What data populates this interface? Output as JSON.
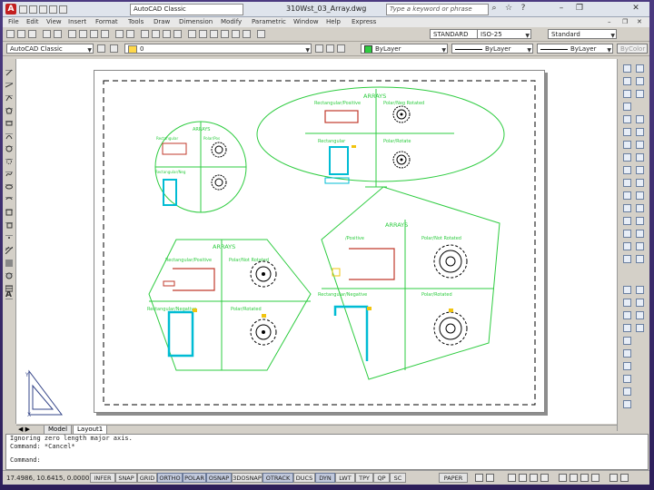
{
  "window": {
    "workspace": "AutoCAD Classic",
    "title": "310Wst_03_Array.dwg",
    "search_placeholder": "Type a keyword or phrase"
  },
  "menu": [
    "File",
    "Edit",
    "View",
    "Insert",
    "Format",
    "Tools",
    "Draw",
    "Dimension",
    "Modify",
    "Parametric",
    "Window",
    "Help",
    "Express"
  ],
  "toolbar2": {
    "workspace_combo": "AutoCAD Classic",
    "text_style": "STANDARD",
    "dim_style": "ISO-25",
    "table_style": "Standard"
  },
  "toolbar3": {
    "layer_combo": "0",
    "color_combo": "ByLayer",
    "linetype_combo": "ByLayer",
    "lineweight_combo": "ByLayer",
    "plotstyle_combo": "ByColor"
  },
  "drawing": {
    "labels": {
      "arrays_top": "ARRAYS",
      "rect_pos_top": "Rectangular/Positive",
      "polar_neg_top": "Polar/Neg Rotated",
      "polar_top": "Polar/Rotate",
      "rect_left": "Rectangular",
      "polar_left": "Polar/Pos",
      "arrays_left": "ARRAYS",
      "rect_neg_left": "Rectangular/Neg",
      "arrays_hex": "ARRAYS",
      "rect_pos_hex": "Rectangular/Positive",
      "polar_rot_hex": "Polar/Not Rotated",
      "rect_neg_hex": "Rectangular/Negative",
      "polar_rotated_hex": "Polar/Rotated",
      "arrays_rot": "ARRAYS",
      "rect_pos_rot": "/Positive",
      "polar_rot_rot": "Polar/Not Rotated",
      "rect_neg_rot": "Rectangular/Negative",
      "polar_rotated_rot": "Polar/Rotated"
    }
  },
  "tabs": [
    "Model",
    "Layout1"
  ],
  "command": {
    "history1": "Ignoring zero length major axis.",
    "history2": "Command: *Cancel*",
    "prompt": "Command:"
  },
  "status": {
    "coords": "17.4986, 10.6415, 0.0000",
    "buttons": [
      "INFER",
      "SNAP",
      "GRID",
      "ORTHO",
      "POLAR",
      "OSNAP",
      "3DOSNAP",
      "OTRACK",
      "DUCS",
      "DYN",
      "LWT",
      "TPY",
      "QP",
      "SC"
    ],
    "paper": "PAPER"
  }
}
